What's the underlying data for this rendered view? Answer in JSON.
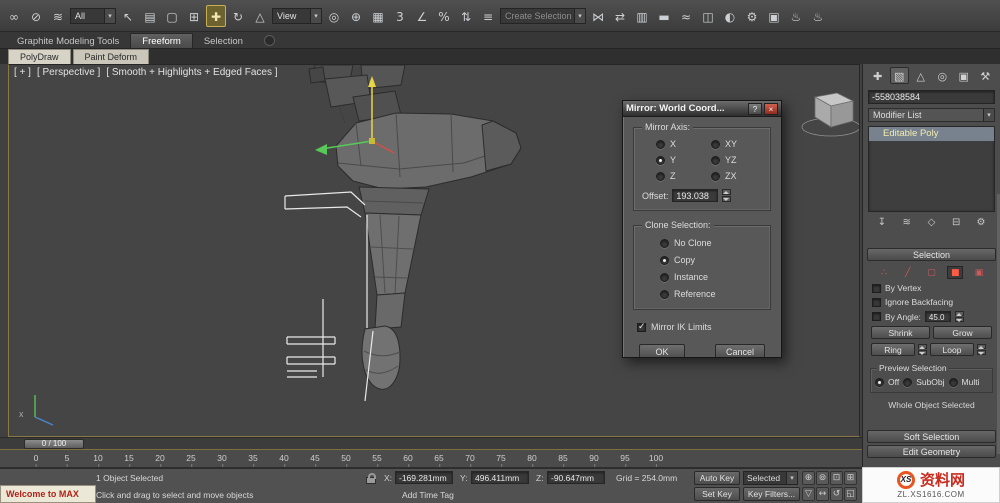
{
  "toolbar": {
    "items": [
      {
        "type": "icon",
        "name": "select-and-link-icon",
        "glyph": "∞"
      },
      {
        "type": "icon",
        "name": "unlink-selection-icon",
        "glyph": "⊘"
      },
      {
        "type": "icon",
        "name": "bind-to-space-warp-icon",
        "glyph": "≋"
      },
      {
        "type": "dropdown",
        "name": "selection-filter-dropdown",
        "value": "All"
      },
      {
        "type": "icon",
        "name": "select-object-icon",
        "glyph": "↖"
      },
      {
        "type": "icon",
        "name": "select-by-name-icon",
        "glyph": "▤"
      },
      {
        "type": "icon",
        "name": "selection-region-icon",
        "glyph": "▢"
      },
      {
        "type": "icon",
        "name": "window-crossing-icon",
        "glyph": "⊞"
      },
      {
        "type": "icon",
        "name": "select-and-move-icon",
        "glyph": "✚",
        "active": true
      },
      {
        "type": "icon",
        "name": "select-and-rotate-icon",
        "glyph": "↻"
      },
      {
        "type": "icon",
        "name": "select-and-scale-icon",
        "glyph": "△"
      },
      {
        "type": "dropdown",
        "name": "reference-coordinate-dropdown",
        "value": "View"
      },
      {
        "type": "icon",
        "name": "use-pivot-center-icon",
        "glyph": "◎"
      },
      {
        "type": "icon",
        "name": "select-and-manipulate-icon",
        "glyph": "⊕"
      },
      {
        "type": "icon",
        "name": "keyboard-override-icon",
        "glyph": "▦"
      },
      {
        "type": "icon",
        "name": "snap-toggle-icon",
        "glyph": "3"
      },
      {
        "type": "icon",
        "name": "angle-snap-icon",
        "glyph": "∠"
      },
      {
        "type": "icon",
        "name": "percent-snap-icon",
        "glyph": "%"
      },
      {
        "type": "icon",
        "name": "spinner-snap-icon",
        "glyph": "⇅"
      },
      {
        "type": "icon",
        "name": "named-selection-sets-icon",
        "glyph": "≡"
      },
      {
        "type": "dropdown",
        "name": "named-selection-dropdown",
        "value": "Create Selection Se",
        "disabled": true
      },
      {
        "type": "icon",
        "name": "mirror-icon",
        "glyph": "⋈"
      },
      {
        "type": "icon",
        "name": "align-icon",
        "glyph": "⇄"
      },
      {
        "type": "icon",
        "name": "layer-manager-icon",
        "glyph": "▥"
      },
      {
        "type": "icon",
        "name": "ribbon-toggle-icon",
        "glyph": "▬"
      },
      {
        "type": "icon",
        "name": "curve-editor-icon",
        "glyph": "≈"
      },
      {
        "type": "icon",
        "name": "schematic-view-icon",
        "glyph": "◫"
      },
      {
        "type": "icon",
        "name": "material-editor-icon",
        "glyph": "◐"
      },
      {
        "type": "icon",
        "name": "render-setup-icon",
        "glyph": "⚙"
      },
      {
        "type": "icon",
        "name": "rendered-frame-icon",
        "glyph": "▣"
      },
      {
        "type": "icon",
        "name": "render-production-icon",
        "glyph": "♨"
      },
      {
        "type": "icon",
        "name": "render-iterative-icon",
        "glyph": "♨"
      }
    ]
  },
  "ribbon": {
    "tabs": [
      {
        "label": "Graphite Modeling Tools",
        "active": false
      },
      {
        "label": "Freeform",
        "active": true
      },
      {
        "label": "Selection",
        "active": false
      }
    ],
    "subtabs": [
      "PolyDraw",
      "Paint Deform"
    ]
  },
  "viewport": {
    "menus": {
      "general": "[ + ]",
      "pov": "[ Perspective ]",
      "shading": "[ Smooth + Highlights + Edged Faces ]"
    },
    "world_axis_label": "x"
  },
  "dialog": {
    "title": "Mirror: World Coord...",
    "help_glyph": "?",
    "close_glyph": "×",
    "mirror_axis": {
      "legend": "Mirror Axis:",
      "options_left": [
        "X",
        "Y",
        "Z"
      ],
      "options_right": [
        "XY",
        "YZ",
        "ZX"
      ],
      "selected": "Y",
      "offset_label": "Offset:",
      "offset_value": "193.038"
    },
    "clone": {
      "legend": "Clone Selection:",
      "options": [
        "No Clone",
        "Copy",
        "Instance",
        "Reference"
      ],
      "selected": "Copy"
    },
    "mirror_ik_label": "Mirror IK Limits",
    "mirror_ik_checked": true,
    "ok_label": "OK",
    "cancel_label": "Cancel"
  },
  "right_panel": {
    "tabs": [
      {
        "name": "create-tab-icon",
        "glyph": "✚"
      },
      {
        "name": "modify-tab-icon",
        "glyph": "▧",
        "active": true
      },
      {
        "name": "hierarchy-tab-icon",
        "glyph": "△"
      },
      {
        "name": "motion-tab-icon",
        "glyph": "◎"
      },
      {
        "name": "display-tab-icon",
        "glyph": "▣"
      },
      {
        "name": "utilities-tab-icon",
        "glyph": "⚒"
      }
    ],
    "object_name": "-558038584",
    "modifier_list_label": "Modifier List",
    "stack": [
      "Editable Poly"
    ],
    "stack_tools": [
      {
        "name": "pin-stack-icon",
        "glyph": "↧"
      },
      {
        "name": "show-end-result-icon",
        "glyph": "≋"
      },
      {
        "name": "make-unique-icon",
        "glyph": "◇"
      },
      {
        "name": "remove-modifier-icon",
        "glyph": "⊟"
      },
      {
        "name": "configure-modifier-sets-icon",
        "glyph": "⚙"
      }
    ],
    "selection": {
      "title": "Selection",
      "subobject_icons": [
        {
          "name": "vertex-icon",
          "glyph": "∴"
        },
        {
          "name": "edge-icon",
          "glyph": "╱"
        },
        {
          "name": "border-icon",
          "glyph": "▢"
        },
        {
          "name": "polygon-icon",
          "glyph": "■",
          "active": true
        },
        {
          "name": "element-icon",
          "glyph": "▣"
        }
      ],
      "by_vertex": "By Vertex",
      "ignore_backfacing": "Ignore Backfacing",
      "by_angle": "By Angle:",
      "by_angle_value": "45.0",
      "shrink": "Shrink",
      "grow": "Grow",
      "ring": "Ring",
      "loop": "Loop",
      "preview_title": "Preview Selection",
      "preview_options": [
        "Off",
        "SubObj",
        "Multi"
      ],
      "preview_selected": "Off",
      "status": "Whole Object Selected"
    },
    "rollouts": [
      "Soft Selection",
      "Edit Geometry"
    ]
  },
  "timeline": {
    "slider_label": "0 / 100",
    "ticks": [
      "0",
      "5",
      "10",
      "15",
      "20",
      "25",
      "30",
      "35",
      "40",
      "45",
      "50",
      "55",
      "60",
      "65",
      "70",
      "75",
      "80",
      "85",
      "90",
      "95",
      "100"
    ]
  },
  "status": {
    "selection_info": "1 Object Selected",
    "prompt": "Click and drag to select and move objects",
    "welcome": "Welcome to MAX",
    "coords": {
      "x_label": "X:",
      "x": "-169.281mm",
      "y_label": "Y:",
      "y": "496.411mm",
      "z_label": "Z:",
      "z": "-90.647mm"
    },
    "grid": "Grid = 254.0mm",
    "add_time_tag": "Add Time Tag",
    "auto_key": "Auto Key",
    "key_mode": "Selected",
    "set_key": "Set Key",
    "key_filters": "Key Filters...",
    "nav_icons": [
      {
        "name": "zoom-icon",
        "glyph": "⊕"
      },
      {
        "name": "zoom-all-icon",
        "glyph": "⊚"
      },
      {
        "name": "zoom-extents-icon",
        "glyph": "⊡"
      },
      {
        "name": "zoom-extents-all-icon",
        "glyph": "⊞"
      },
      {
        "name": "field-of-view-icon",
        "glyph": "▽"
      },
      {
        "name": "pan-icon",
        "glyph": "↔"
      },
      {
        "name": "orbit-icon",
        "glyph": "↺"
      },
      {
        "name": "maximize-viewport-icon",
        "glyph": "◱"
      }
    ]
  },
  "watermark": {
    "logo": "XS",
    "site_name": "资料网",
    "url": "ZL.XS1616.COM"
  }
}
